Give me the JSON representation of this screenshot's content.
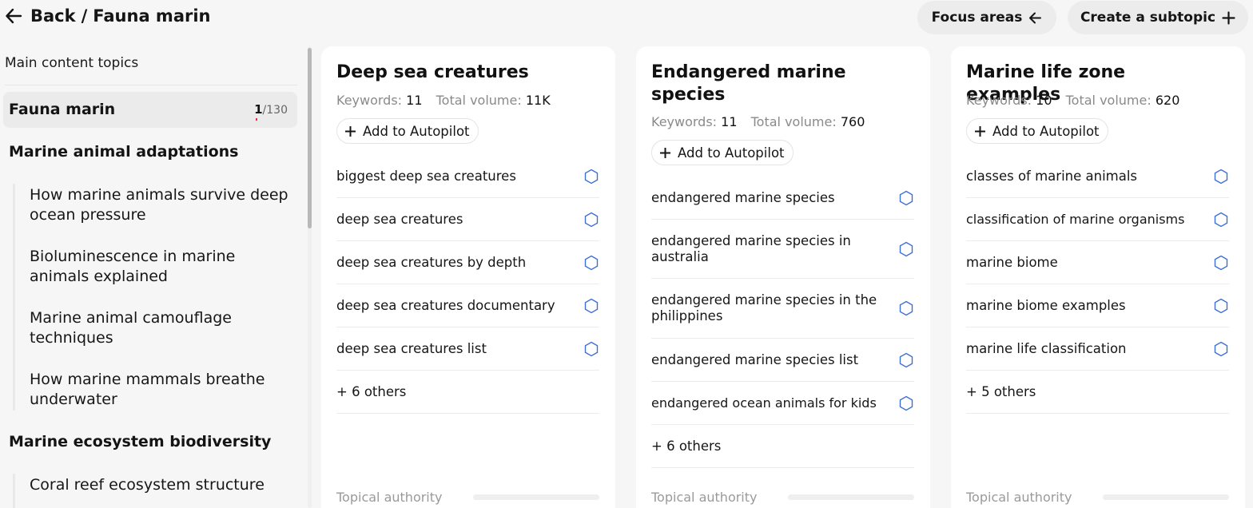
{
  "header": {
    "back_label": "Back",
    "separator": "/",
    "breadcrumb_current": "Fauna marin",
    "focus_areas_label": "Focus areas",
    "create_subtopic_label": "Create a subtopic"
  },
  "sidebar": {
    "heading": "Main content topics",
    "selected": {
      "name": "Fauna marin",
      "count_current": "1",
      "count_total": "/130"
    },
    "groups": [
      {
        "title": "Marine animal adaptations",
        "items": [
          "How marine animals survive deep ocean pressure",
          "Bioluminescence in marine animals explained",
          "Marine animal camouflage techniques",
          "How marine mammals breathe underwater"
        ]
      },
      {
        "title": "Marine ecosystem biodiversity",
        "items": [
          "Coral reef ecosystem structure"
        ]
      }
    ]
  },
  "cards": [
    {
      "title": "Deep sea creatures",
      "keywords_label": "Keywords:",
      "keywords_value": "11",
      "volume_label": "Total volume:",
      "volume_value": "11K",
      "add_label": "Add to Autopilot",
      "keywords": [
        "biggest deep sea creatures",
        "deep sea creatures",
        "deep sea creatures by depth",
        "deep sea creatures documentary",
        "deep sea creatures list"
      ],
      "others": "+ 6 others",
      "authority_label": "Topical authority"
    },
    {
      "title": "Endangered marine species",
      "keywords_label": "Keywords:",
      "keywords_value": "11",
      "volume_label": "Total volume:",
      "volume_value": "760",
      "add_label": "Add to Autopilot",
      "keywords": [
        "endangered marine species",
        "endangered marine species in australia",
        "endangered marine species in the philippines",
        "endangered marine species list",
        "endangered ocean animals for kids"
      ],
      "others": "+ 6 others",
      "authority_label": "Topical authority"
    },
    {
      "title": "Marine life zone examples",
      "keywords_label": "Keywords:",
      "keywords_value": "10",
      "volume_label": "Total volume:",
      "volume_value": "620",
      "add_label": "Add to Autopilot",
      "keywords": [
        "classes of marine animals",
        "classification of marine organisms",
        "marine biome",
        "marine biome examples",
        "marine life classification"
      ],
      "others": "+ 5 others",
      "authority_label": "Topical authority"
    }
  ],
  "colors": {
    "background": "#f6f6f6",
    "card": "#ffffff",
    "pill": "#ececec",
    "hex_icon": "#3d6fd6",
    "muted_text": "#8a8a8a"
  },
  "icons": [
    "arrow-left-icon",
    "plus-icon",
    "hexagon-icon"
  ]
}
